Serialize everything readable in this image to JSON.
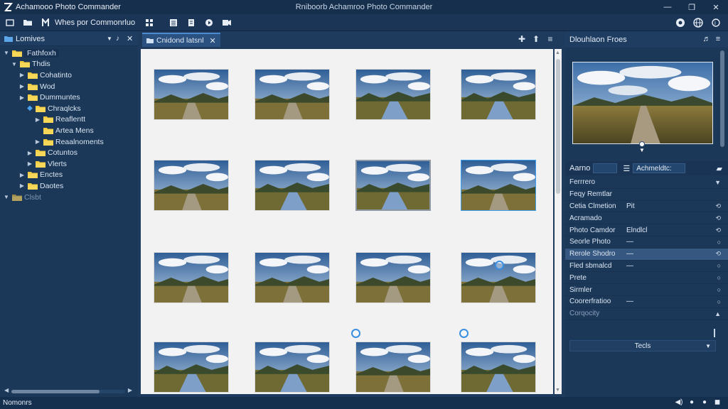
{
  "window": {
    "app_title": "Achamooo Photo Commander",
    "center_title": "Rniboorb Achamroo Photo Commander",
    "controls": [
      "—",
      "❐",
      "✕"
    ]
  },
  "toolbar": {
    "menu_label": "Whes por Commonrluo"
  },
  "left_panel": {
    "header": "Lomives",
    "tree": [
      {
        "label": "Fathfoxh",
        "level": 0,
        "arrow": "▼",
        "selected": true,
        "dim": false
      },
      {
        "label": "Thdis",
        "level": 1,
        "arrow": "▼",
        "selected": false,
        "dim": false
      },
      {
        "label": "Cohatinto",
        "level": 2,
        "arrow": "▶",
        "selected": false,
        "dim": false
      },
      {
        "label": "Wod",
        "level": 2,
        "arrow": "▶",
        "selected": false,
        "dim": false
      },
      {
        "label": "Dummuntes",
        "level": 2,
        "arrow": "▶",
        "selected": false,
        "dim": false
      },
      {
        "label": "Chraqlcks",
        "level": 3,
        "arrow": "◆",
        "selected": false,
        "dim": false
      },
      {
        "label": "Reaflentt",
        "level": 4,
        "arrow": "▶",
        "selected": false,
        "dim": false
      },
      {
        "label": "Artea Mens",
        "level": 4,
        "arrow": "",
        "selected": false,
        "dim": false
      },
      {
        "label": "Reaalnoments",
        "level": 4,
        "arrow": "▶",
        "selected": false,
        "dim": false
      },
      {
        "label": "Cotuntos",
        "level": 3,
        "arrow": "▶",
        "selected": false,
        "dim": false
      },
      {
        "label": "Vlerts",
        "level": 3,
        "arrow": "▶",
        "selected": false,
        "dim": false
      },
      {
        "label": "Enctes",
        "level": 2,
        "arrow": "▶",
        "selected": false,
        "dim": false
      },
      {
        "label": "Daotes",
        "level": 2,
        "arrow": "▶",
        "selected": false,
        "dim": false
      },
      {
        "label": "Clsbt",
        "level": 0,
        "arrow": "▼",
        "selected": false,
        "dim": true
      }
    ]
  },
  "center_panel": {
    "tab_label": "Cnidond latsnl",
    "tab_close": "✕"
  },
  "right_panel": {
    "header": "Dlouhlaon Froes",
    "meta_label": "Aarno",
    "meta_dropdown": "Achmeldtc:",
    "rows": [
      {
        "key": "Ferrrero",
        "value": "",
        "icon": "▼",
        "hl": false,
        "dim": false
      },
      {
        "key": "Feqy Remtlar",
        "value": "",
        "icon": "",
        "hl": false,
        "dim": false
      },
      {
        "key": "Cetia Clmetion",
        "value": "Pit",
        "icon": "⟲",
        "hl": false,
        "dim": false
      },
      {
        "key": "Acramado",
        "value": "",
        "icon": "⟲",
        "hl": false,
        "dim": false
      },
      {
        "key": "Photo Camdor",
        "value": "Elndlcl",
        "icon": "⟲",
        "hl": false,
        "dim": false
      },
      {
        "key": "Seorle Photo",
        "value": "—",
        "icon": "○",
        "hl": false,
        "dim": false
      },
      {
        "key": "Rerole Shodro",
        "value": "—",
        "icon": "⟲",
        "hl": true,
        "dim": false
      },
      {
        "key": "Fled sbmalcd",
        "value": "—",
        "icon": "○",
        "hl": false,
        "dim": false
      },
      {
        "key": "Prete",
        "value": "",
        "icon": "○",
        "hl": false,
        "dim": false
      },
      {
        "key": "Sirmler",
        "value": "",
        "icon": "○",
        "hl": false,
        "dim": false
      },
      {
        "key": "Coorerfratioo",
        "value": "—",
        "icon": "○",
        "hl": false,
        "dim": false
      },
      {
        "key": "Corqocity",
        "value": "",
        "icon": "▲",
        "hl": false,
        "dim": true
      }
    ],
    "tools_label": "Tecls"
  },
  "statusbar": {
    "text": "Nomonrs"
  },
  "thumbnails": [
    {
      "scene": "path"
    },
    {
      "scene": "path"
    },
    {
      "scene": "river"
    },
    {
      "scene": "river"
    },
    {
      "scene": "path"
    },
    {
      "scene": "river"
    },
    {
      "scene": "river"
    },
    {
      "scene": "path"
    },
    {
      "scene": "path"
    },
    {
      "scene": "path"
    },
    {
      "scene": "path"
    },
    {
      "scene": "path"
    },
    {
      "scene": "river"
    },
    {
      "scene": "river"
    },
    {
      "scene": "path"
    },
    {
      "scene": "river"
    }
  ]
}
